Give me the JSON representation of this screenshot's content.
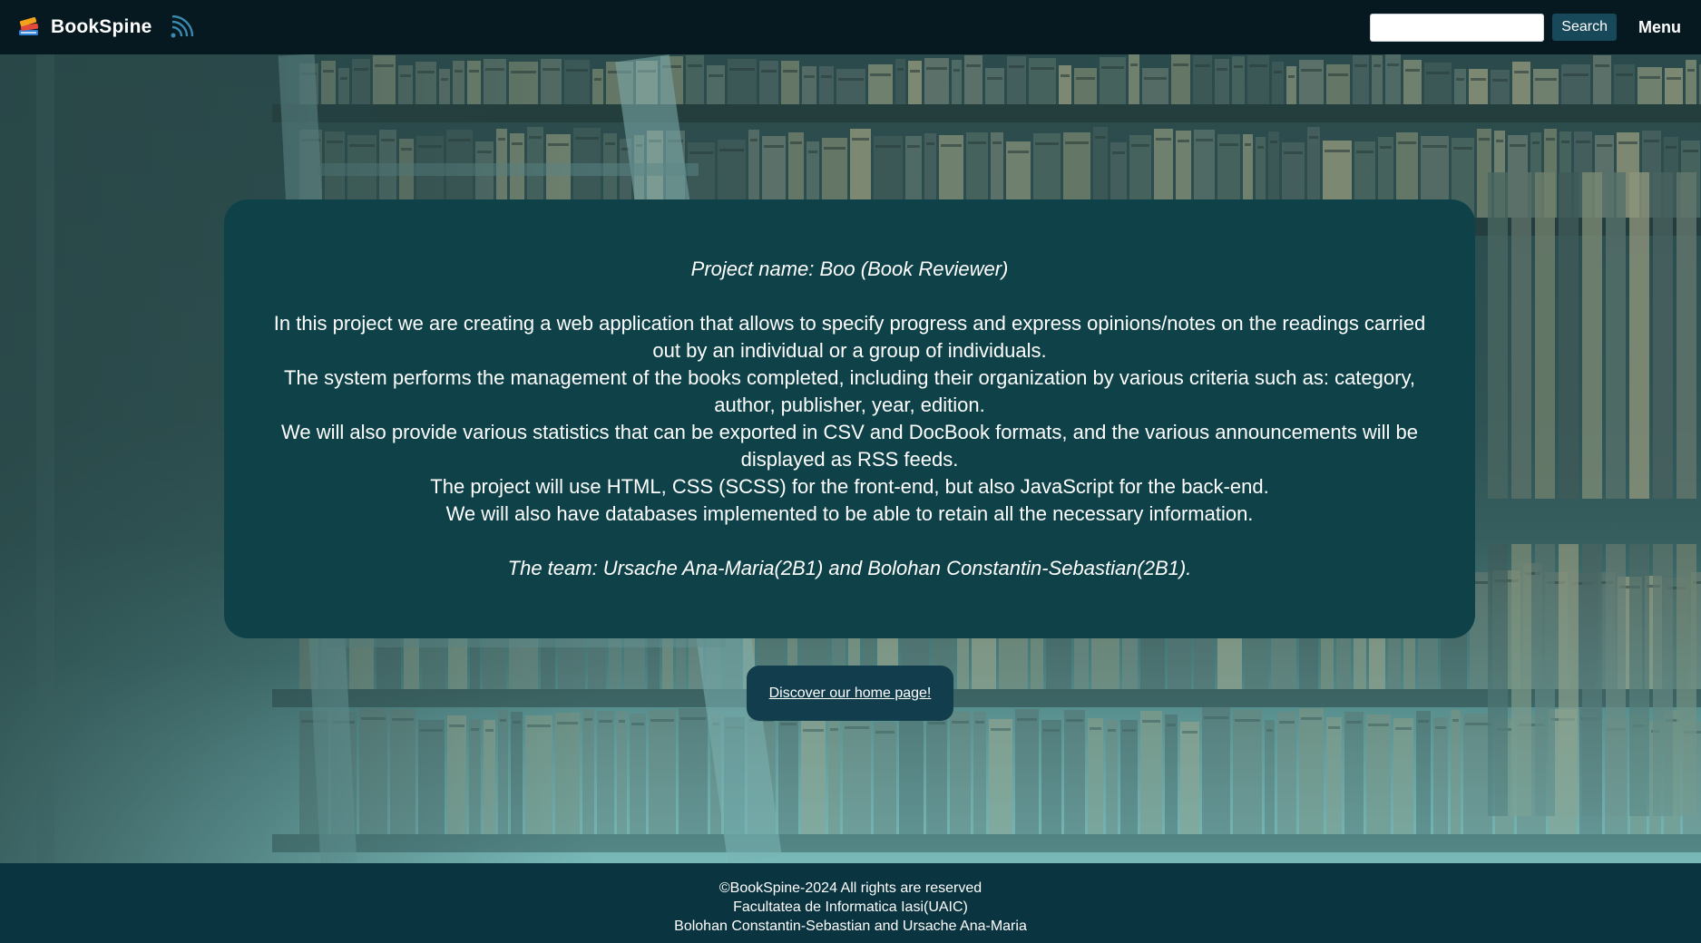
{
  "header": {
    "brand_name": "BookSpine",
    "logo_icon": "books-stack-icon",
    "rss_icon": "rss-feed-icon",
    "search": {
      "value": "",
      "placeholder": ""
    },
    "search_button_label": "Search",
    "menu_label": "Menu"
  },
  "info": {
    "project_name": "Project name: Boo (Book Reviewer)",
    "description_lines": [
      "In this project we are creating a web application that allows to specify progress and express opinions/notes on the readings carried out by an individual or a group of individuals.",
      "The system performs the management of the books completed, including their organization by various criteria such as: category, author, publisher, year, edition.",
      "We will also provide various statistics that can be exported in CSV and DocBook formats, and the various announcements will be displayed as RSS feeds.",
      "The project will use HTML, CSS (SCSS) for the front-end, but also JavaScript for the back-end.",
      "We will also have databases implemented to be able to retain all the necessary information."
    ],
    "team": "The team: Ursache Ana-Maria(2B1) and Bolohan Constantin-Sebastian(2B1)."
  },
  "home_link_label": "Discover our home page!",
  "footer": {
    "copyright": "©BookSpine-2024 All rights are reserved",
    "faculty": "Facultatea de Informatica Iasi(UAIC)",
    "authors": "Bolohan Constantin-Sebastian and Ursache Ana-Maria"
  },
  "colors": {
    "header_bg": "#061820",
    "card_bg": "#0e4248",
    "button_bg": "#113d4d",
    "footer_bg": "#0a3440",
    "search_button_bg": "#17495a"
  }
}
